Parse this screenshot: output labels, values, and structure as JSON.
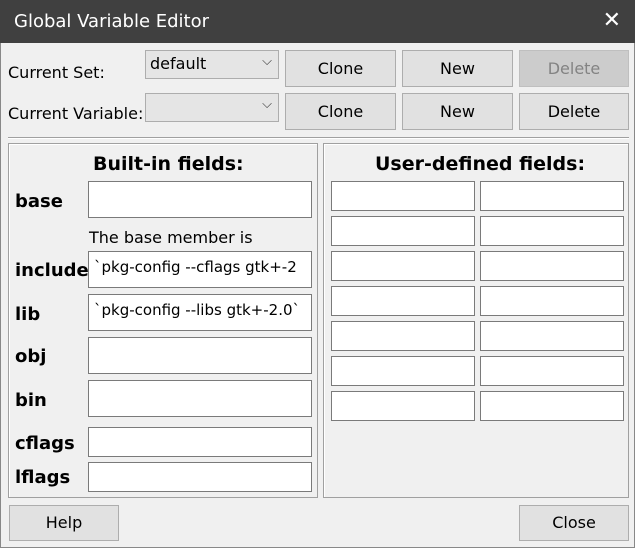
{
  "window": {
    "title": "Global Variable Editor",
    "close_glyph": "✕"
  },
  "top": {
    "current_set_label": "Current Set:",
    "current_set_value": "default",
    "current_variable_label": "Current Variable:",
    "current_variable_value": "",
    "set_buttons": {
      "clone": "Clone",
      "new": "New",
      "delete": "Delete"
    },
    "variable_buttons": {
      "clone": "Clone",
      "new": "New",
      "delete": "Delete"
    }
  },
  "builtin": {
    "header": "Built-in fields:",
    "base_note": "The base member is",
    "fields": [
      {
        "label": "base",
        "value": ""
      },
      {
        "label": "include",
        "value": "`pkg-config --cflags gtk+-2"
      },
      {
        "label": "lib",
        "value": "`pkg-config --libs gtk+-2.0`"
      },
      {
        "label": "obj",
        "value": ""
      },
      {
        "label": "bin",
        "value": ""
      },
      {
        "label": "cflags",
        "value": ""
      },
      {
        "label": "lflags",
        "value": ""
      }
    ]
  },
  "userdefined": {
    "header": "User-defined fields:"
  },
  "bottom": {
    "help": "Help",
    "close": "Close"
  }
}
